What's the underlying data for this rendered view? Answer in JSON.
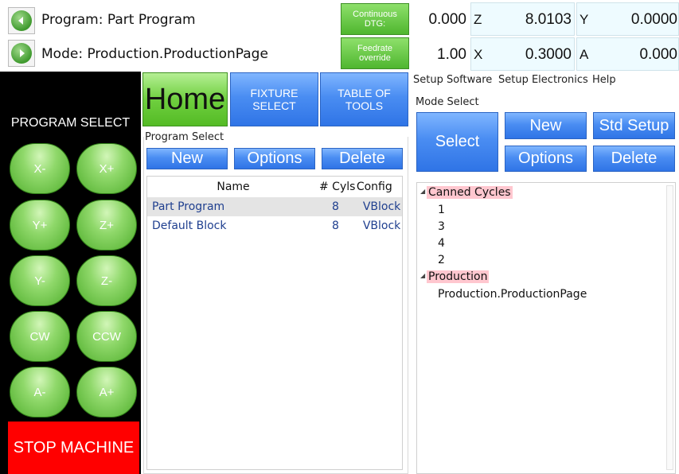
{
  "status": {
    "program_label": "Program: Part Program",
    "mode_label": "Mode: Production.ProductionPage",
    "continuous_dtg": [
      "Continuous",
      "DTG:"
    ],
    "feedrate_override": [
      "Feedrate",
      "override"
    ],
    "dtg_value": "0.000",
    "feedrate_value": "1.00",
    "axes": [
      {
        "letter": "Z",
        "value": "8.0103"
      },
      {
        "letter": "Y",
        "value": "0.0000"
      },
      {
        "letter": "X",
        "value": "0.3000"
      },
      {
        "letter": "A",
        "value": "0.000"
      }
    ]
  },
  "left": {
    "title": "PROGRAM SELECT",
    "jog": [
      "X-",
      "X+",
      "Y+",
      "Z+",
      "Y-",
      "Z-",
      "CW",
      "CCW",
      "A-",
      "A+"
    ],
    "stop": "STOP MACHINE"
  },
  "tabs": {
    "home": "Home",
    "fixture": [
      "FIXTURE",
      "SELECT"
    ],
    "tools": [
      "TABLE OF",
      "TOOLS"
    ]
  },
  "program_select": {
    "label": "Program Select",
    "buttons": {
      "new": "New",
      "options": "Options",
      "delete": "Delete"
    },
    "columns": [
      "Name",
      "# Cyls",
      "Config"
    ],
    "rows": [
      {
        "name": "Part Program",
        "cyls": "8",
        "config": "VBlock"
      },
      {
        "name": "Default Block",
        "cyls": "8",
        "config": "VBlock"
      }
    ]
  },
  "menu": [
    "Setup Software",
    "Setup Electronics",
    "Help"
  ],
  "mode_select": {
    "label": "Mode Select",
    "buttons": {
      "select": "Select",
      "new": "New",
      "std_setup": "Std Setup",
      "options": "Options",
      "delete": "Delete"
    },
    "tree": {
      "canned": "Canned Cycles",
      "canned_children": [
        "1",
        "3",
        "4",
        "2"
      ],
      "production": "Production",
      "production_children": [
        "Production.ProductionPage"
      ]
    }
  },
  "colors": {
    "green": "#4fb62f",
    "blue": "#2f74e6",
    "stop": "#ff0000",
    "highlight": "#ffc7cf"
  }
}
